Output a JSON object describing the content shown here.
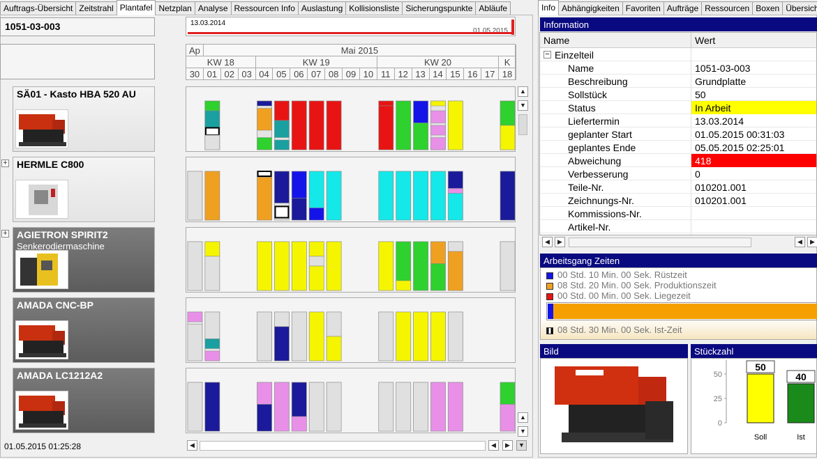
{
  "left_tabs": [
    "Auftrags-Übersicht",
    "Zeitstrahl",
    "Plantafel",
    "Netzplan",
    "Analyse",
    "Ressourcen Info",
    "Auslastung",
    "Kollisionsliste",
    "Sicherungspunkte",
    "Abläufe"
  ],
  "left_active_tab": 2,
  "right_tabs": [
    "Info",
    "Abhängigkeiten",
    "Favoriten",
    "Aufträge",
    "Ressourcen",
    "Boxen",
    "Übersicht"
  ],
  "right_active_tab": 0,
  "order_number": "1051-03-003",
  "timeline": {
    "start": "13.03.2014",
    "end": "01.05.2015"
  },
  "calendar": {
    "months": [
      "Ap",
      "Mai 2015"
    ],
    "weeks": [
      "KW 18",
      "KW 19",
      "KW 20",
      "K"
    ],
    "days": [
      "30",
      "01",
      "02",
      "03",
      "04",
      "05",
      "06",
      "07",
      "08",
      "09",
      "10",
      "11",
      "12",
      "13",
      "14",
      "15",
      "16",
      "17",
      "18"
    ]
  },
  "machines": [
    {
      "name": "SÄ01 - Kasto  HBA 520 AU",
      "subtitle": "",
      "style": "light",
      "expander": false
    },
    {
      "name": "HERMLE C800",
      "subtitle": "",
      "style": "light",
      "expander": true
    },
    {
      "name": "AGIETRON SPIRIT2",
      "subtitle": "Senkerodiermaschine",
      "style": "dark",
      "expander": true
    },
    {
      "name": "AMADA CNC-BP",
      "subtitle": "",
      "style": "dark",
      "expander": false
    },
    {
      "name": "AMADA LC1212A2",
      "subtitle": "",
      "style": "dark",
      "expander": false
    }
  ],
  "footer_timestamp": "01.05.2015 01:25:28",
  "colors": {
    "yellow": "#f5f500",
    "red": "#e81414",
    "green": "#2ed12e",
    "teal": "#1aa0a0",
    "cyan": "#14e8e8",
    "navy": "#1a1a9a",
    "blue": "#1414e8",
    "orange": "#f0a020",
    "pink": "#e890e8",
    "grey": "#e0e0e0"
  },
  "info": {
    "header": "Information",
    "col_name": "Name",
    "col_value": "Wert",
    "group": "Einzelteil",
    "rows": [
      {
        "name": "Name",
        "value": "1051-03-003",
        "bg": ""
      },
      {
        "name": "Beschreibung",
        "value": "Grundplatte",
        "bg": ""
      },
      {
        "name": "Sollstück",
        "value": "50",
        "bg": ""
      },
      {
        "name": "Status",
        "value": "In Arbeit",
        "bg": "#ffff00"
      },
      {
        "name": "Liefertermin",
        "value": "13.03.2014",
        "bg": ""
      },
      {
        "name": "geplanter Start",
        "value": "01.05.2015 00:31:03",
        "bg": ""
      },
      {
        "name": "geplantes Ende",
        "value": "05.05.2015 02:25:01",
        "bg": ""
      },
      {
        "name": "Abweichung",
        "value": "418",
        "bg": "#ff0000"
      },
      {
        "name": "Verbesserung",
        "value": "0",
        "bg": ""
      },
      {
        "name": "Teile-Nr.",
        "value": "010201.001",
        "bg": ""
      },
      {
        "name": "Zeichnungs-Nr.",
        "value": "010201.001",
        "bg": ""
      },
      {
        "name": "Kommissions-Nr.",
        "value": "",
        "bg": ""
      },
      {
        "name": "Artikel-Nr.",
        "value": "",
        "bg": ""
      }
    ]
  },
  "times": {
    "header": "Arbeitsgang Zeiten",
    "items": [
      {
        "label": "00 Std. 10 Min. 00 Sek. Rüstzeit",
        "color": "#1414e8"
      },
      {
        "label": "08 Std. 20 Min. 00 Sek. Produktionszeit",
        "color": "#f0a020"
      },
      {
        "label": "00 Std. 00 Min. 00 Sek. Liegezeit",
        "color": "#e81414"
      }
    ],
    "actual": "08 Std. 30 Min. 00 Sek. Ist-Zeit"
  },
  "image_panel": {
    "header": "Bild"
  },
  "count_panel": {
    "header": "Stückzahl",
    "chart_data": {
      "type": "bar",
      "categories": [
        "Soll",
        "Ist"
      ],
      "values": [
        50,
        40
      ],
      "ylim": [
        0,
        60
      ],
      "yticks": [
        0,
        25,
        50
      ],
      "colors": [
        "#ffff00",
        "#1a8a1a"
      ]
    }
  }
}
